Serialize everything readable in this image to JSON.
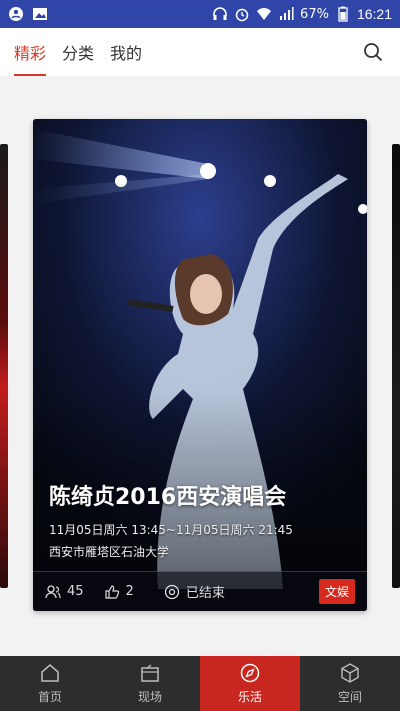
{
  "status_bar": {
    "battery": "67%",
    "time": "16:21"
  },
  "top_tabs": [
    {
      "label": "精彩",
      "active": true
    },
    {
      "label": "分类",
      "active": false
    },
    {
      "label": "我的",
      "active": false
    }
  ],
  "search": {
    "icon": "search-icon"
  },
  "event_card": {
    "title": "陈绮贞2016西安演唱会",
    "time_range": "11月05日周六 13:45~11月05日周六 21:45",
    "location": "西安市雁塔区石油大学",
    "attendees_count": "45",
    "likes_count": "2",
    "status": "已结束",
    "tag": "文娱",
    "tag_color": "#d62a1f"
  },
  "bottom_nav": [
    {
      "label": "首页",
      "icon": "home-icon",
      "active": false
    },
    {
      "label": "现场",
      "icon": "scene-icon",
      "active": false
    },
    {
      "label": "乐活",
      "icon": "compass-icon",
      "active": true
    },
    {
      "label": "空间",
      "icon": "cube-icon",
      "active": false
    }
  ],
  "colors": {
    "status_bar_bg": "#2f46a8",
    "accent_red": "#d43b2a",
    "nav_active_bg": "#c7271e",
    "nav_bg": "#2d2d2d"
  }
}
